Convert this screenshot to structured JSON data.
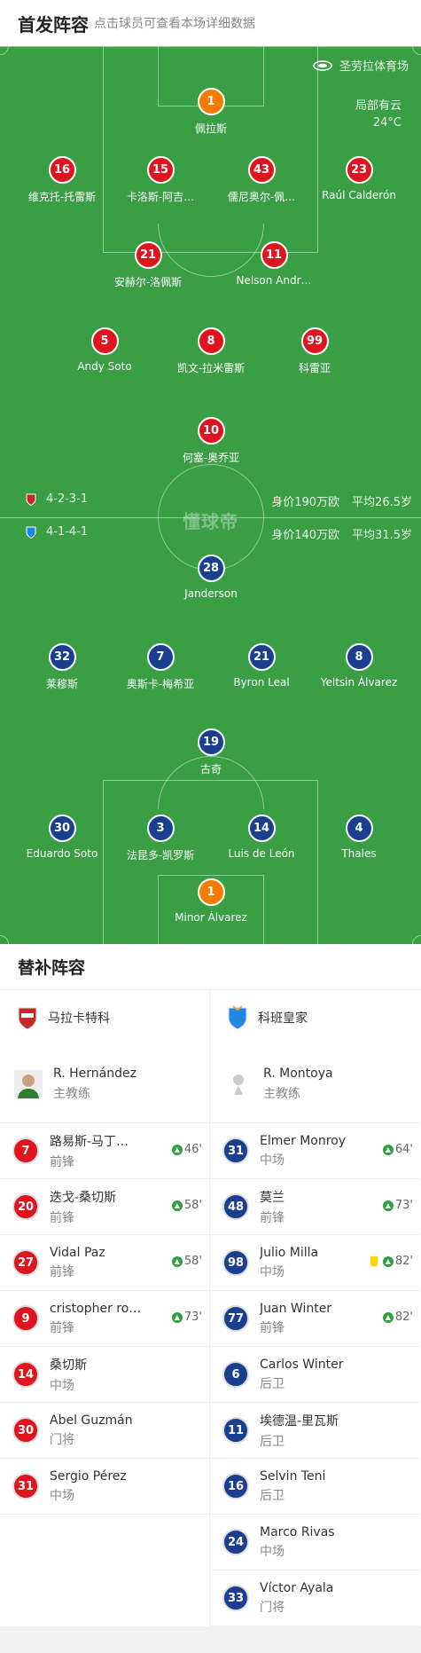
{
  "header": {
    "title": "首发阵容",
    "subtitle": "点击球员可查看本场详细数据"
  },
  "pitch": {
    "venue": "圣劳拉体育场",
    "weather": "局部有云",
    "temperature": "24°C",
    "watermark": "懂球帝",
    "home_team": {
      "formation": "4-2-3-1",
      "value": "身价190万欧",
      "avg_age": "平均26.5岁",
      "color": "#e0141e"
    },
    "away_team": {
      "formation": "4-1-4-1",
      "value": "身价140万欧",
      "avg_age": "平均31.5岁",
      "color": "#1b3f8f"
    },
    "home_players": [
      {
        "num": "1",
        "name": "佩拉斯",
        "gk": true
      },
      {
        "num": "16",
        "name": "维克托-托雷斯",
        "sub_min": "46'"
      },
      {
        "num": "15",
        "name": "卡洛斯-阿吉…",
        "yellow": true
      },
      {
        "num": "43",
        "name": "儒尼奥尔-佩…"
      },
      {
        "num": "23",
        "name": "Raúl Calderón"
      },
      {
        "num": "21",
        "name": "安赫尔-洛佩斯",
        "sub_min": "58'"
      },
      {
        "num": "11",
        "name": "Nelson Andr…",
        "yellow": true
      },
      {
        "num": "5",
        "name": "Andy Soto",
        "sub_min": "58'"
      },
      {
        "num": "8",
        "name": "凯文-拉米雷斯"
      },
      {
        "num": "99",
        "name": "科雷亚"
      },
      {
        "num": "10",
        "name": "何塞-奥乔亚",
        "sub_min": "73'"
      }
    ],
    "away_players": [
      {
        "num": "28",
        "name": "Janderson"
      },
      {
        "num": "32",
        "name": "莱穆斯",
        "sub_min": "73'"
      },
      {
        "num": "7",
        "name": "奥斯卡-梅希亚",
        "yellow": true
      },
      {
        "num": "21",
        "name": "Byron Leal",
        "sub_min": "82'"
      },
      {
        "num": "8",
        "name": "Yeltsin Álvarez",
        "sub_min": "82'",
        "goal": true
      },
      {
        "num": "19",
        "name": "古奇",
        "sub_min": "64'"
      },
      {
        "num": "30",
        "name": "Eduardo Soto"
      },
      {
        "num": "3",
        "name": "法昆多-凯罗斯"
      },
      {
        "num": "14",
        "name": "Luis de León"
      },
      {
        "num": "4",
        "name": "Thales"
      },
      {
        "num": "1",
        "name": "Minor Álvarez",
        "gk": true
      }
    ]
  },
  "subs": {
    "title": "替补阵容",
    "home": {
      "team": "马拉卡特科",
      "coach": {
        "name": "R. Hernández",
        "role": "主教练"
      },
      "players": [
        {
          "num": "7",
          "name": "路易斯-马丁…",
          "pos": "前锋",
          "in": "46'"
        },
        {
          "num": "20",
          "name": "迭戈-桑切斯",
          "pos": "前锋",
          "in": "58'"
        },
        {
          "num": "27",
          "name": "Vidal Paz",
          "pos": "前锋",
          "in": "58'"
        },
        {
          "num": "9",
          "name": "cristopher rob…",
          "pos": "前锋",
          "in": "73'"
        },
        {
          "num": "14",
          "name": "桑切斯",
          "pos": "中场"
        },
        {
          "num": "30",
          "name": "Abel Guzmán",
          "pos": "门将"
        },
        {
          "num": "31",
          "name": "Sergio Pérez",
          "pos": "中场"
        }
      ]
    },
    "away": {
      "team": "科班皇家",
      "coach": {
        "name": "R. Montoya",
        "role": "主教练"
      },
      "players": [
        {
          "num": "31",
          "name": "Elmer Monroy",
          "pos": "中场",
          "in": "64'"
        },
        {
          "num": "48",
          "name": "莫兰",
          "pos": "前锋",
          "in": "73'"
        },
        {
          "num": "98",
          "name": "Julio Milla",
          "pos": "中场",
          "in": "82'",
          "yellow": true
        },
        {
          "num": "77",
          "name": "Juan Winter",
          "pos": "前锋",
          "in": "82'"
        },
        {
          "num": "6",
          "name": "Carlos Winter",
          "pos": "后卫"
        },
        {
          "num": "11",
          "name": "埃德温-里瓦斯",
          "pos": "后卫"
        },
        {
          "num": "16",
          "name": "Selvin Teni",
          "pos": "后卫"
        },
        {
          "num": "24",
          "name": "Marco Rivas",
          "pos": "中场"
        },
        {
          "num": "33",
          "name": "Víctor Ayala",
          "pos": "门将"
        }
      ]
    }
  }
}
